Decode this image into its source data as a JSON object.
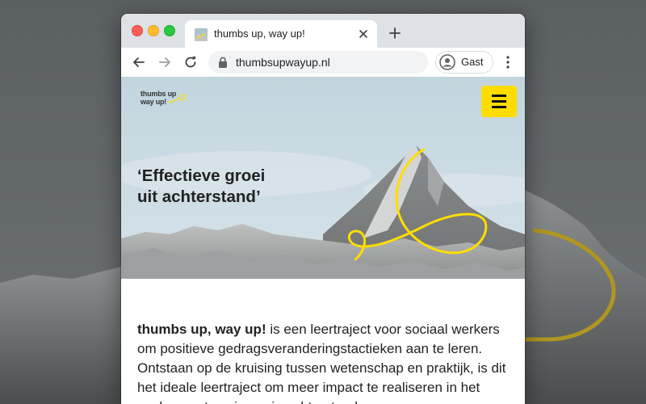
{
  "window": {
    "tab_title": "thumbs up, way up!",
    "url": "thumbsupwayup.nl",
    "profile_name": "Gast"
  },
  "icons": {
    "back": "arrow-left-icon",
    "forward": "arrow-right-icon",
    "reload": "reload-icon",
    "lock": "lock-icon",
    "new_tab": "plus-icon",
    "menu": "three-dots-icon",
    "site_menu": "hamburger-icon"
  },
  "site": {
    "logo_line1": "thumbs up",
    "logo_line2": "way up!",
    "headline_line1": "‘Effectieve groei",
    "headline_line2": "uit achterstand’",
    "intro_brand": "thumbs up, way up!",
    "intro_text": " is een leertraject voor sociaal werkers om positieve gedragsveranderingstactieken aan te leren. Ontstaan op de kruising tussen wetenschap en praktijk, is dit het ideale leertraject om meer impact te realiseren in het werken met gezinnen in achterstand."
  },
  "colors": {
    "accent_yellow": "#ffdd00",
    "sky": "#c9d9e1",
    "tabbar": "#dee1e6"
  }
}
